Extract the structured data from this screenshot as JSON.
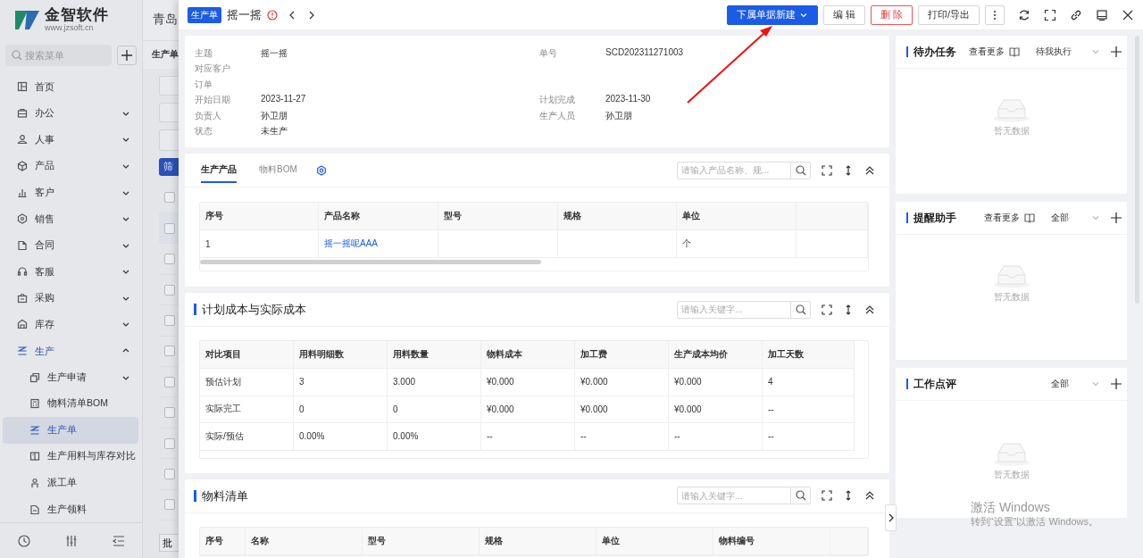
{
  "sidebar": {
    "logo": {
      "name": "金智软件",
      "url": "www.jzsoft.cn"
    },
    "search": {
      "placeholder": "搜索菜单"
    },
    "items": [
      {
        "label": "首页",
        "kind": "link",
        "selected": false
      },
      {
        "label": "办公",
        "kind": "group",
        "expanded": false,
        "selected": false
      },
      {
        "label": "人事",
        "kind": "group",
        "expanded": false,
        "selected": false
      },
      {
        "label": "产品",
        "kind": "group",
        "expanded": false,
        "selected": false
      },
      {
        "label": "客户",
        "kind": "group",
        "expanded": false,
        "selected": false
      },
      {
        "label": "销售",
        "kind": "group",
        "expanded": false,
        "selected": false
      },
      {
        "label": "合同",
        "kind": "group",
        "expanded": false,
        "selected": false
      },
      {
        "label": "客服",
        "kind": "group",
        "expanded": false,
        "selected": false
      },
      {
        "label": "采购",
        "kind": "group",
        "expanded": false,
        "selected": false
      },
      {
        "label": "库存",
        "kind": "group",
        "expanded": false,
        "selected": false
      },
      {
        "label": "生产",
        "kind": "group",
        "expanded": true,
        "selected": false,
        "children": [
          {
            "label": "生产申请",
            "kind": "group",
            "expanded": false,
            "selected": false
          },
          {
            "label": "物料清单BOM",
            "kind": "link",
            "selected": false
          },
          {
            "label": "生产单",
            "kind": "link",
            "selected": true
          },
          {
            "label": "生产用料与库存对比",
            "kind": "link",
            "selected": false
          },
          {
            "label": "派工单",
            "kind": "link",
            "selected": false
          },
          {
            "label": "生产领料",
            "kind": "link",
            "selected": false
          }
        ]
      }
    ]
  },
  "background_page": {
    "company": "青岛",
    "tab": "生产单",
    "filter_button": "筛",
    "batch_button": "批",
    "rows": [
      {
        "checked": false
      },
      {
        "checked": false
      },
      {
        "checked": false
      },
      {
        "checked": false
      },
      {
        "checked": false
      },
      {
        "checked": false
      },
      {
        "checked": false
      },
      {
        "checked": false
      },
      {
        "checked": false
      },
      {
        "checked": false
      },
      {
        "checked": false
      }
    ]
  },
  "drawer": {
    "doc_type": "生产单",
    "title": "摇一摇",
    "actions": [
      {
        "label": "下属单据新建",
        "kind": "primary",
        "caret": true
      },
      {
        "label": "编 辑",
        "kind": "default",
        "caret": false
      },
      {
        "label": "删 除",
        "kind": "danger",
        "caret": false
      },
      {
        "label": "打印/导出",
        "kind": "default",
        "caret": false
      }
    ],
    "details": [
      {
        "left": {
          "label": "主题",
          "value": "摇一摇"
        },
        "right": {
          "label": "单号",
          "value": "SCD202311271003"
        }
      },
      {
        "left": {
          "label": "对应客户"
        }
      },
      {
        "left": {
          "label": "订单"
        }
      },
      {
        "left": {
          "label": "开始日期",
          "value": "2023-11-27"
        },
        "right": {
          "label": "计划完成",
          "value": "2023-11-30"
        }
      },
      {
        "left": {
          "label": "负责人",
          "value": "孙卫朋"
        },
        "right": {
          "label": "生产人员",
          "value": "孙卫朋"
        }
      },
      {
        "left": {
          "label": "状态",
          "value": "未生产"
        }
      }
    ],
    "products": {
      "tabs": [
        {
          "label": "生产产品",
          "selected": true
        },
        {
          "label": "物料BOM",
          "selected": false
        }
      ],
      "search": {
        "placeholder": "请输入产品名称、规..."
      },
      "columns": [
        "序号",
        "产品名称",
        "型号",
        "规格",
        "单位"
      ],
      "rows": [
        [
          {
            "text": "1",
            "kind": "text"
          },
          {
            "text": "摇一摇呢AAA",
            "kind": "link"
          },
          null,
          null,
          {
            "text": "个",
            "kind": "text"
          }
        ]
      ]
    },
    "cost": {
      "title": "计划成本与实际成本",
      "search": {
        "placeholder": "请输入关键字..."
      },
      "columns": [
        "对比项目",
        "用料明细数",
        "用料数量",
        "物料成本",
        "加工费",
        "生产成本均价",
        "加工天数"
      ],
      "rows": [
        [
          "预估计划",
          "3",
          "3.000",
          "¥0.000",
          "¥0.000",
          "¥0.000",
          "4"
        ],
        [
          "实际完工",
          "0",
          "0",
          "¥0.000",
          "¥0.000",
          "¥0.000",
          "--"
        ],
        [
          "实际/预估",
          "0.00%",
          "0.00%",
          "--",
          "--",
          "--",
          "--"
        ]
      ]
    },
    "materials": {
      "title": "物料清单",
      "search": {
        "placeholder": "请输入关键字..."
      },
      "columns": [
        "序号",
        "名称",
        "型号",
        "规格",
        "单位",
        "物料编号"
      ]
    },
    "panels": [
      {
        "title": "待办任务",
        "more": "查看更多",
        "filter": "待我执行",
        "empty": "暂无数据"
      },
      {
        "title": "提醒助手",
        "more": "查看更多",
        "filter": "全部",
        "empty": "暂无数据"
      },
      {
        "title": "工作点评",
        "filter": "全部",
        "empty": "暂无数据"
      }
    ]
  },
  "os_notice": {
    "title": "激活 Windows",
    "text": "转到“设置”以激活 Windows。"
  }
}
